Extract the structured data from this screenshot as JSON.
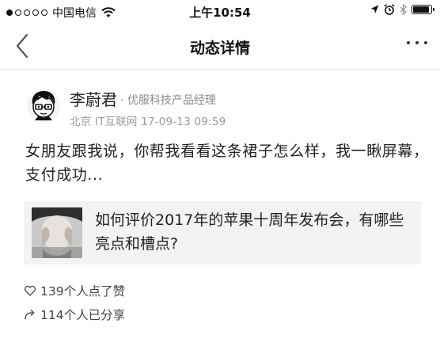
{
  "status_bar": {
    "carrier": "中国电信",
    "time": "上午10:54",
    "battery_level": 0.85
  },
  "nav": {
    "title": "动态详情"
  },
  "post": {
    "author_name": "李蔚君",
    "author_title": "· 优服科技产品经理",
    "meta": "北京 IT互联网 17-09-13 09:59",
    "text": "女朋友跟我说，你帮我看看这条裙子怎么样，我一瞅屏幕，支付成功...",
    "question": {
      "title": "如何评价2017年的苹果十周年发布会，有哪些亮点和槽点?"
    },
    "likes_text": "139个人点了赞",
    "shares_text": "114个人已分享"
  },
  "icons": {
    "back": "chevron-left-icon",
    "more": "ellipsis-icon",
    "like": "heart-outline-icon",
    "share": "share-arrow-icon"
  }
}
